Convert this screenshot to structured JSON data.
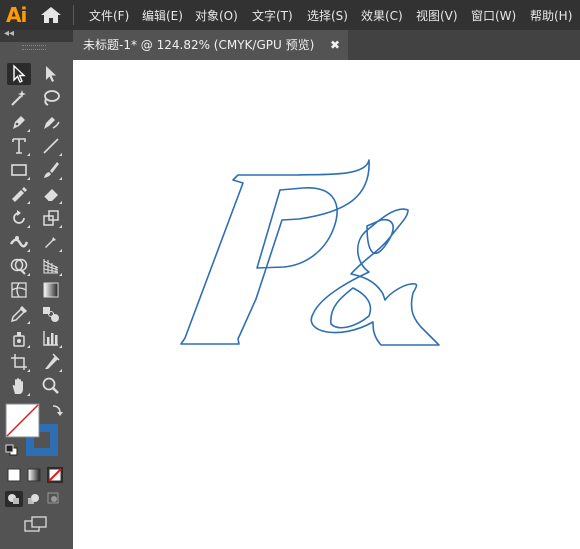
{
  "app": {
    "logo": "Ai"
  },
  "menu": [
    {
      "label": "文件(F)"
    },
    {
      "label": "编辑(E)"
    },
    {
      "label": "对象(O)"
    },
    {
      "label": "文字(T)"
    },
    {
      "label": "选择(S)"
    },
    {
      "label": "效果(C)"
    },
    {
      "label": "视图(V)"
    },
    {
      "label": "窗口(W)"
    },
    {
      "label": "帮助(H)"
    }
  ],
  "toolbar": {
    "collapse_glyph": "◂◂"
  },
  "document": {
    "tab_title": "未标题-1* @ 124.82% (CMYK/GPU 预览)",
    "close_glyph": "✖"
  },
  "artwork": {
    "text": "P&",
    "stroke_color": "#2e6fb4"
  },
  "colors": {
    "fill": "#ffffff",
    "stroke": "#2e6fb4",
    "none_slash": "#e01e1e"
  },
  "icons": [
    "home-icon",
    "selection-tool-icon",
    "direct-selection-tool-icon",
    "magic-wand-icon",
    "lasso-icon",
    "pen-icon",
    "curvature-icon",
    "type-icon",
    "line-icon",
    "rectangle-icon",
    "paintbrush-icon",
    "shaper-icon",
    "eraser-icon",
    "rotate-icon",
    "scale-icon",
    "width-icon",
    "puppet-warp-icon",
    "shape-builder-icon",
    "perspective-grid-icon",
    "mesh-icon",
    "gradient-icon",
    "eyedropper-icon",
    "blend-icon",
    "symbol-sprayer-icon",
    "column-graph-icon",
    "artboard-icon",
    "slice-icon",
    "hand-icon",
    "zoom-icon",
    "swap-icon",
    "default-colors-icon",
    "color-mode-icon",
    "gradient-mode-icon",
    "none-mode-icon",
    "draw-normal-icon",
    "draw-behind-icon",
    "draw-inside-icon",
    "screen-mode-icon"
  ]
}
